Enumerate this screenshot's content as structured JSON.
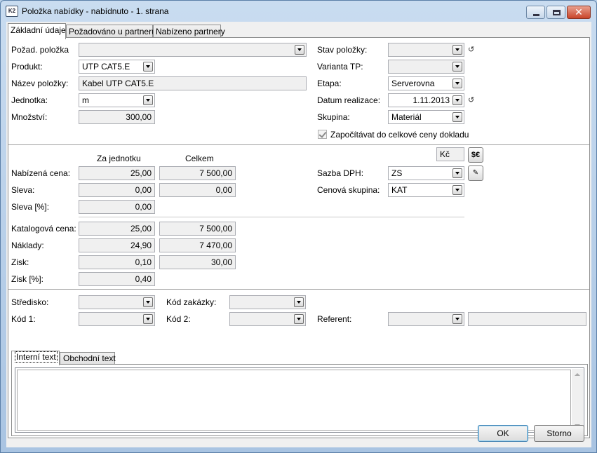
{
  "window": {
    "title": "Položka nabídky - nabídnuto - 1. strana",
    "app_icon_text": "K2",
    "close_glyph": "✕"
  },
  "tabs": [
    {
      "label": "Základní údaje",
      "active": true
    },
    {
      "label": "Požadováno u partnerů",
      "active": false
    },
    {
      "label": "Nabízeno partnery",
      "active": false
    }
  ],
  "left_fields": {
    "pozad_polozka": {
      "label": "Požad. položka",
      "value": ""
    },
    "produkt": {
      "label": "Produkt:",
      "value": "UTP CAT5.E"
    },
    "nazev_polozky": {
      "label": "Název položky:",
      "value": "Kabel UTP CAT5.E"
    },
    "jednotka": {
      "label": "Jednotka:",
      "value": "m"
    },
    "mnozstvi": {
      "label": "Množství:",
      "value": "300,00"
    }
  },
  "right_fields": {
    "stav_polozky": {
      "label": "Stav položky:",
      "value": ""
    },
    "varianta_tp": {
      "label": "Varianta TP:",
      "value": ""
    },
    "etapa": {
      "label": "Etapa:",
      "value": "Serverovna"
    },
    "datum_realizace": {
      "label": "Datum realizace:",
      "value": "1.11.2013"
    },
    "skupina": {
      "label": "Skupina:",
      "value": "Materiál"
    },
    "zapocitavat": {
      "label": "Započítávat do celkové ceny dokladu",
      "checked": true
    }
  },
  "pricing": {
    "col_unit": "Za jednotku",
    "col_total": "Celkem",
    "currency": "Kč",
    "currency_button": "$€",
    "rows": [
      {
        "label": "Nabízená cena:",
        "unit": "25,00",
        "total": "7 500,00"
      },
      {
        "label": "Sleva:",
        "unit": "0,00",
        "total": "0,00"
      },
      {
        "label": "Sleva [%]:",
        "unit": "0,00",
        "total": null
      },
      {
        "label": "Katalogová cena:",
        "unit": "25,00",
        "total": "7 500,00"
      },
      {
        "label": "Náklady:",
        "unit": "24,90",
        "total": "7 470,00"
      },
      {
        "label": "Zisk:",
        "unit": "0,10",
        "total": "30,00"
      },
      {
        "label": "Zisk [%]:",
        "unit": "0,40",
        "total": null
      }
    ],
    "sazba_dph": {
      "label": "Sazba DPH:",
      "value": "ZS"
    },
    "cenova_skupina": {
      "label": "Cenová skupina:",
      "value": "KAT"
    }
  },
  "codes": {
    "stredisko": {
      "label": "Středisko:",
      "value": ""
    },
    "kod_zakazky": {
      "label": "Kód zakázky:",
      "value": ""
    },
    "kod1": {
      "label": "Kód 1:",
      "value": ""
    },
    "kod2": {
      "label": "Kód 2:",
      "value": ""
    },
    "referent": {
      "label": "Referent:",
      "value": "",
      "extra": ""
    }
  },
  "subtabs": [
    {
      "label": "Interní text",
      "active": true
    },
    {
      "label": "Obchodní text",
      "active": false
    }
  ],
  "text_content": "",
  "buttons": {
    "ok": "OK",
    "cancel": "Storno"
  },
  "icons": {
    "history": "↺"
  }
}
